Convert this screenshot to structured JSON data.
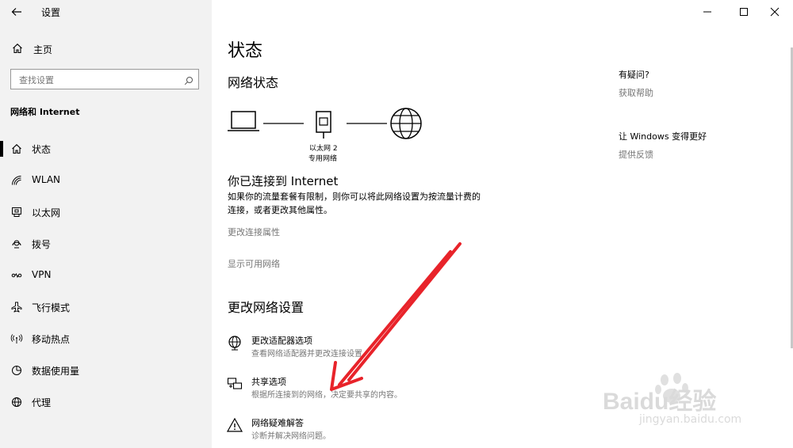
{
  "window": {
    "title": "设置"
  },
  "sidebar": {
    "home": "主页",
    "search_placeholder": "查找设置",
    "section_title": "网络和 Internet",
    "items": [
      {
        "label": "状态",
        "icon": "home-status-icon"
      },
      {
        "label": "WLAN",
        "icon": "wifi-icon"
      },
      {
        "label": "以太网",
        "icon": "ethernet-icon"
      },
      {
        "label": "拨号",
        "icon": "dialup-icon"
      },
      {
        "label": "VPN",
        "icon": "vpn-icon"
      },
      {
        "label": "飞行模式",
        "icon": "airplane-icon"
      },
      {
        "label": "移动热点",
        "icon": "hotspot-icon"
      },
      {
        "label": "数据使用量",
        "icon": "data-usage-icon"
      },
      {
        "label": "代理",
        "icon": "globe-icon"
      }
    ]
  },
  "main": {
    "page_title": "状态",
    "network_status_heading": "网络状态",
    "adapter_name": "以太网 2",
    "network_type": "专用网络",
    "connected_heading": "你已连接到 Internet",
    "connected_desc_line1": "如果你的流量套餐有限制，则你可以将此网络设置为按流量计费的",
    "connected_desc_line2": "连接，或者更改其他属性。",
    "link_change_props": "更改连接属性",
    "link_show_networks": "显示可用网络",
    "change_settings_heading": "更改网络设置",
    "options": [
      {
        "title": "更改适配器选项",
        "desc": "查看网络适配器并更改连接设置。"
      },
      {
        "title": "共享选项",
        "desc": "根据所连接到的网络，决定要共享的内容。"
      },
      {
        "title": "网络疑难解答",
        "desc": "诊断并解决网络问题。"
      }
    ]
  },
  "right_panel": {
    "question_heading": "有疑问?",
    "get_help": "获取帮助",
    "improve_heading": "让 Windows 变得更好",
    "feedback": "提供反馈"
  },
  "watermark": {
    "brand": "Baidu经验",
    "url": "jingyan.baidu.com"
  },
  "colors": {
    "annotation_arrow": "#e8232a",
    "sidebar_bg": "#f2f2f2",
    "link_gray": "#767676"
  }
}
